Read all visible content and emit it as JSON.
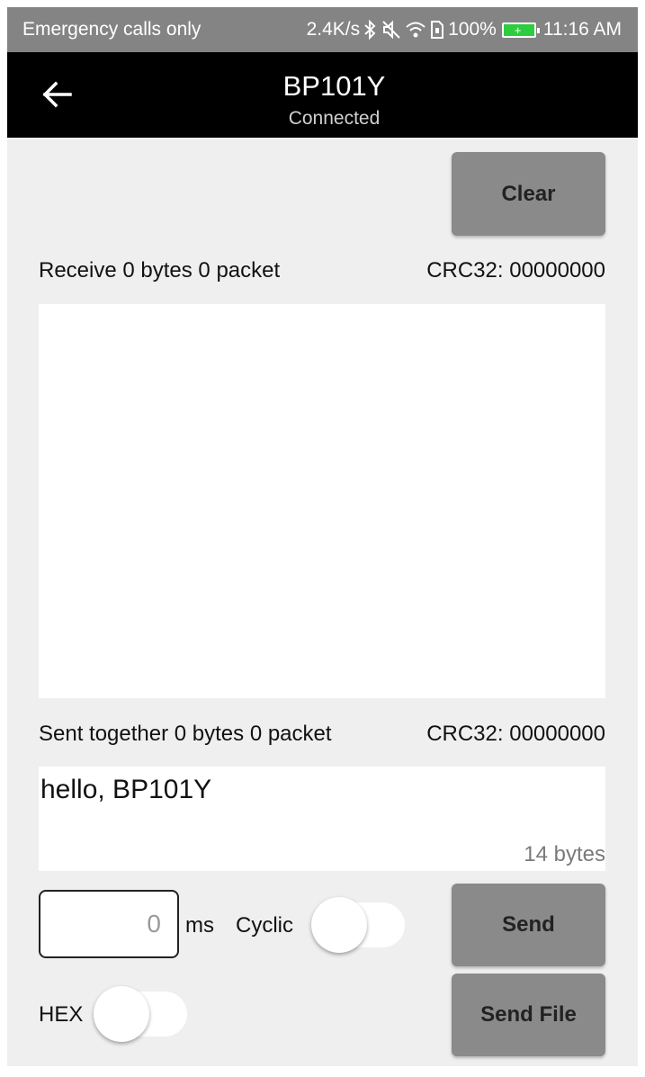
{
  "status_bar": {
    "left_text": "Emergency calls only",
    "speed": "2.4K/s",
    "battery_percent": "100%",
    "time": "11:16 AM",
    "icons": [
      "bluetooth-icon",
      "mute-icon",
      "wifi-icon",
      "sim-icon",
      "battery-icon"
    ],
    "battery_color": "#2ecc40"
  },
  "app_bar": {
    "title": "BP101Y",
    "subtitle": "Connected",
    "background": "#000000"
  },
  "toolbar": {
    "clear_label": "Clear"
  },
  "receive": {
    "label": "Receive 0 bytes 0 packet",
    "crc": "CRC32: 00000000",
    "content": ""
  },
  "sent": {
    "label": "Sent together 0 bytes 0 packet",
    "crc": "CRC32: 00000000",
    "input_value": "hello, BP101Y",
    "byte_count": "14 bytes"
  },
  "controls": {
    "interval_value": "0",
    "ms_label": "ms",
    "cyclic_label": "Cyclic",
    "cyclic_on": false,
    "hex_label": "HEX",
    "hex_on": false,
    "send_label": "Send",
    "send_file_label": "Send File",
    "button_color": "#8a8a8a"
  }
}
